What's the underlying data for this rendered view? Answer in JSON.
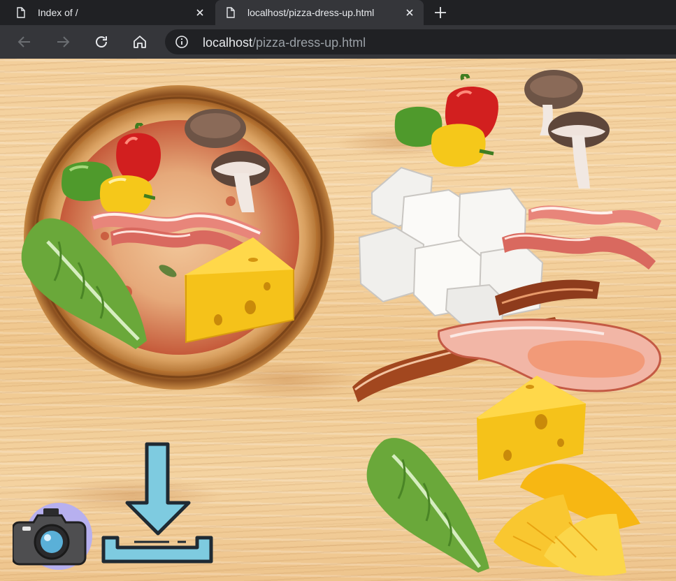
{
  "browser": {
    "tabs": [
      {
        "title": "Index of /",
        "active": false
      },
      {
        "title": "localhost/pizza-dress-up.html",
        "active": true
      }
    ],
    "address": {
      "host": "localhost",
      "path": "/pizza-dress-up.html"
    }
  },
  "page": {
    "board_color": "#f3cf9b",
    "pizza_toppings": [
      "red-pepper",
      "green-pepper",
      "yellow-pepper",
      "mushroom",
      "bacon",
      "lettuce",
      "cheese"
    ],
    "topping_palette": [
      "peppers",
      "mushrooms",
      "tofu-cubes",
      "bacon-strips",
      "fried-bacon",
      "ham-steak",
      "cheese-wedge",
      "lettuce-leaf",
      "pineapple"
    ],
    "tools": [
      {
        "name": "camera",
        "icon": "camera-icon"
      },
      {
        "name": "download",
        "icon": "download-icon"
      }
    ]
  }
}
